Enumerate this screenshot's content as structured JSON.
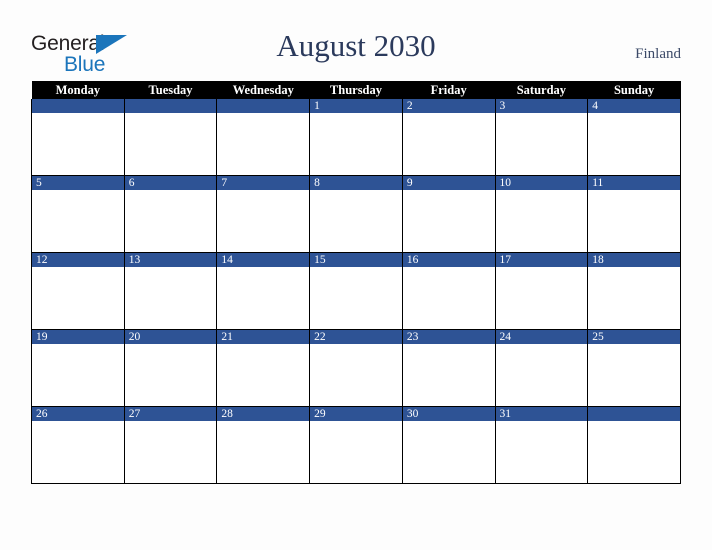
{
  "brand": {
    "line_one": "General",
    "line_two": "Blue",
    "triangle_icon": "triangle-icon",
    "color_dark": "#231f20",
    "color_blue": "#1b75bb"
  },
  "header": {
    "title": "August 2030",
    "country": "Finland",
    "title_color": "#2b3a5c"
  },
  "calendar": {
    "accent_color": "#2e5395",
    "header_background": "#000000",
    "weekday_headers": [
      "Monday",
      "Tuesday",
      "Wednesday",
      "Thursday",
      "Friday",
      "Saturday",
      "Sunday"
    ],
    "weeks": [
      [
        "",
        "",
        "",
        "1",
        "2",
        "3",
        "4"
      ],
      [
        "5",
        "6",
        "7",
        "8",
        "9",
        "10",
        "11"
      ],
      [
        "12",
        "13",
        "14",
        "15",
        "16",
        "17",
        "18"
      ],
      [
        "19",
        "20",
        "21",
        "22",
        "23",
        "24",
        "25"
      ],
      [
        "26",
        "27",
        "28",
        "29",
        "30",
        "31",
        ""
      ]
    ]
  }
}
